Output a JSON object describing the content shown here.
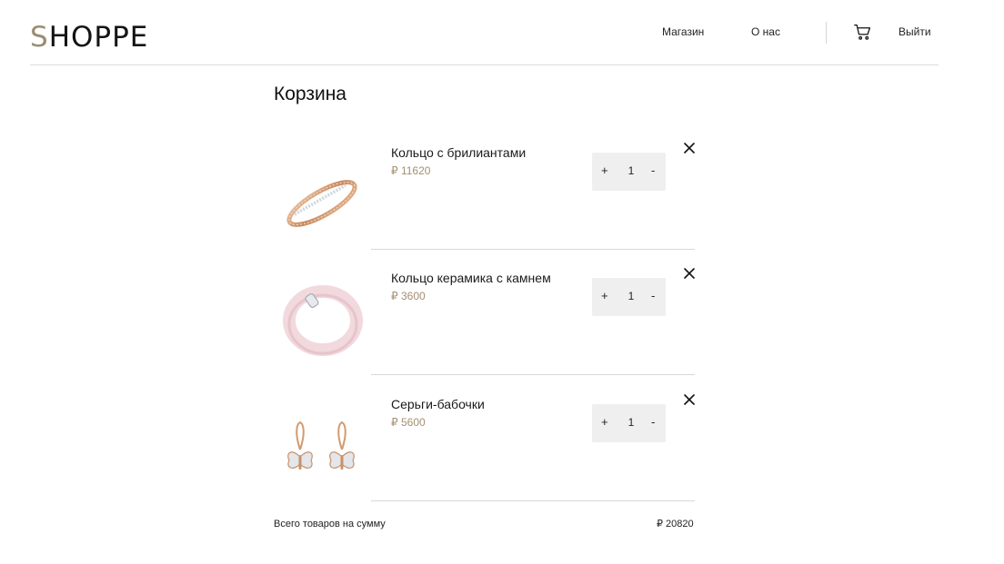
{
  "header": {
    "logo_first": "S",
    "logo_rest": "HOPPE",
    "nav": {
      "shop": "Магазин",
      "about": "О нас",
      "logout": "Выйти"
    },
    "cart_icon": "cart-icon"
  },
  "page": {
    "title": "Корзина"
  },
  "cart": {
    "items": [
      {
        "name": "Кольцо с брилиантами",
        "price": "₽ 11620",
        "qty": "1",
        "image": "ring-diamonds-image"
      },
      {
        "name": "Кольцо керамика с камнем",
        "price": "₽ 3600",
        "qty": "1",
        "image": "ring-ceramic-image"
      },
      {
        "name": "Серьги-бабочки",
        "price": "₽ 5600",
        "qty": "1",
        "image": "earrings-butterfly-image"
      }
    ],
    "plus_label": "+",
    "minus_label": "-",
    "total_label": "Всего товаров на сумму",
    "total_value": "₽ 20820"
  },
  "colors": {
    "accent": "#a38f70",
    "logo_accent": "#9c8c75",
    "qty_bg": "#efefef"
  }
}
